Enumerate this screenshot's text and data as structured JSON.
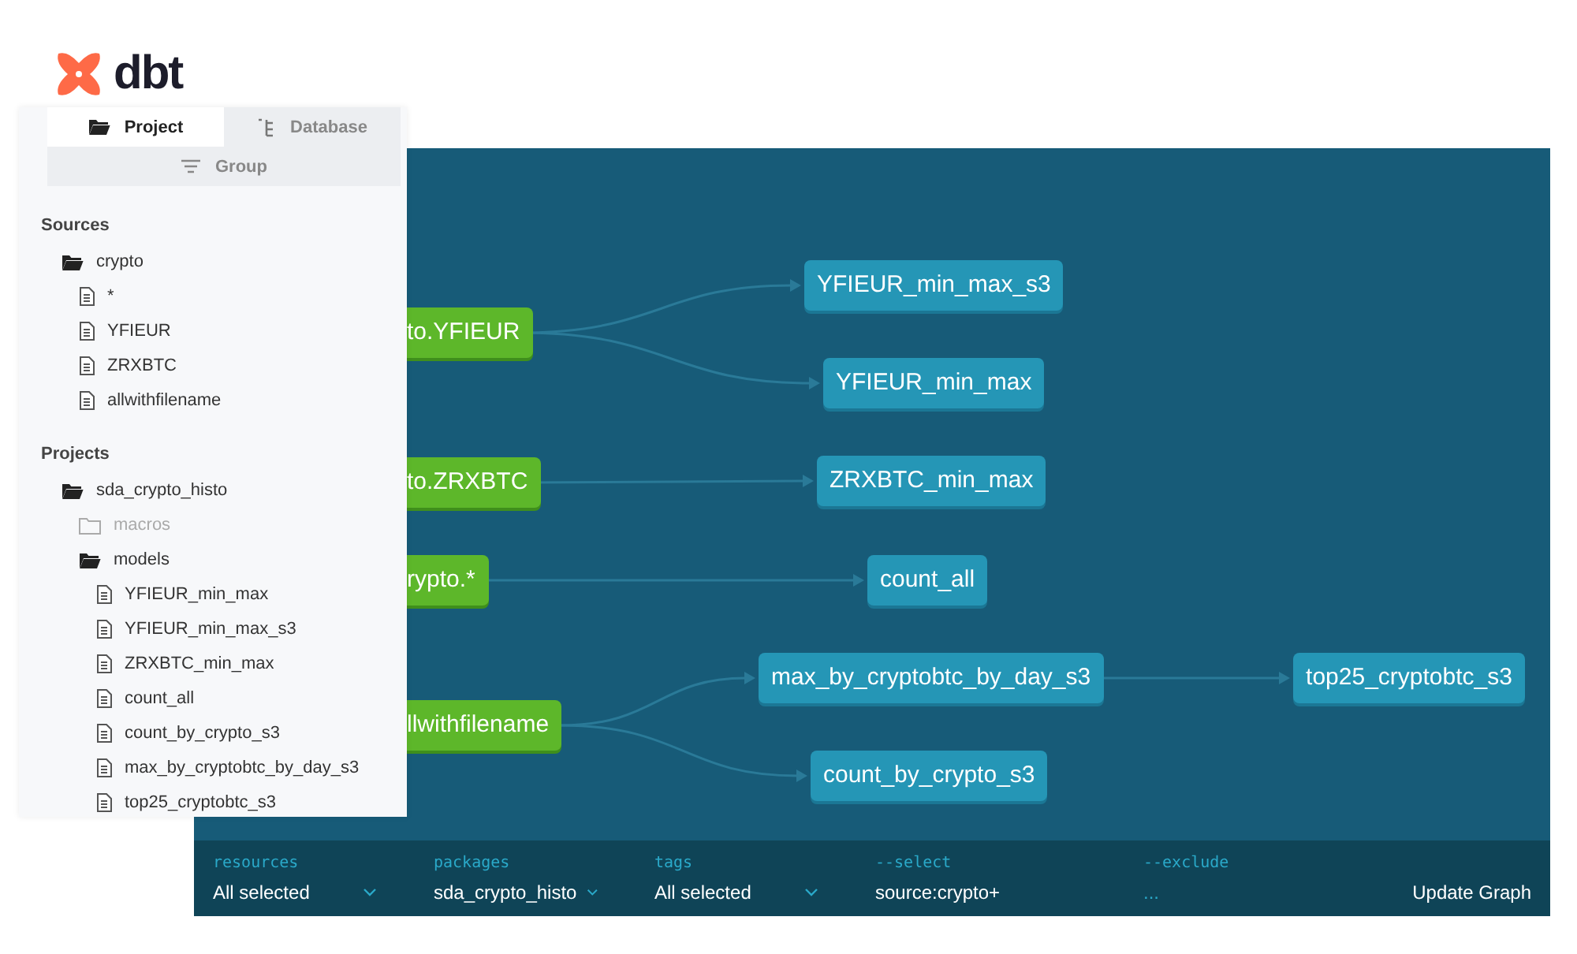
{
  "logo": {
    "text": "dbt"
  },
  "sidebar": {
    "tabs": [
      {
        "label": "Project",
        "selected": true,
        "kind": "folder"
      },
      {
        "label": "Database",
        "selected": false,
        "kind": "tree"
      }
    ],
    "group_button": "Group",
    "sections": [
      {
        "title": "Sources",
        "tree": [
          {
            "label": "crypto",
            "kind": "folder",
            "expanded": true,
            "disabled": false,
            "children": [
              {
                "label": "*",
                "kind": "file"
              },
              {
                "label": "YFIEUR",
                "kind": "file"
              },
              {
                "label": "ZRXBTC",
                "kind": "file"
              },
              {
                "label": "allwithfilename",
                "kind": "file"
              }
            ]
          }
        ]
      },
      {
        "title": "Projects",
        "tree": [
          {
            "label": "sda_crypto_histo",
            "kind": "folder",
            "expanded": true,
            "disabled": false,
            "children": [
              {
                "label": "macros",
                "kind": "folder",
                "expanded": false,
                "disabled": true
              },
              {
                "label": "models",
                "kind": "folder",
                "expanded": true,
                "disabled": false,
                "children": [
                  {
                    "label": "YFIEUR_min_max",
                    "kind": "file"
                  },
                  {
                    "label": "YFIEUR_min_max_s3",
                    "kind": "file"
                  },
                  {
                    "label": "ZRXBTC_min_max",
                    "kind": "file"
                  },
                  {
                    "label": "count_all",
                    "kind": "file"
                  },
                  {
                    "label": "count_by_crypto_s3",
                    "kind": "file"
                  },
                  {
                    "label": "max_by_cryptobtc_by_day_s3",
                    "kind": "file"
                  },
                  {
                    "label": "top25_cryptobtc_s3",
                    "kind": "file"
                  }
                ]
              }
            ]
          }
        ]
      }
    ]
  },
  "graph": {
    "nodes": [
      {
        "label": "to.YFIEUR",
        "kind": "source"
      },
      {
        "label": "to.ZRXBTC",
        "kind": "source"
      },
      {
        "label": "rypto.*",
        "kind": "source"
      },
      {
        "label": "llwithfilename",
        "kind": "source"
      },
      {
        "label": "YFIEUR_min_max_s3",
        "kind": "model"
      },
      {
        "label": "YFIEUR_min_max",
        "kind": "model"
      },
      {
        "label": "ZRXBTC_min_max",
        "kind": "model"
      },
      {
        "label": "count_all",
        "kind": "model"
      },
      {
        "label": "max_by_cryptobtc_by_day_s3",
        "kind": "model"
      },
      {
        "label": "count_by_crypto_s3",
        "kind": "model"
      },
      {
        "label": "top25_cryptobtc_s3",
        "kind": "model"
      }
    ]
  },
  "filters": [
    {
      "label": "resources",
      "kind": "dropdown",
      "value": "All selected"
    },
    {
      "label": "packages",
      "kind": "dropdown",
      "value": "sda_crypto_histo"
    },
    {
      "label": "tags",
      "kind": "dropdown",
      "value": "All selected"
    },
    {
      "label": "--select",
      "kind": "text",
      "value": "source:crypto+"
    },
    {
      "label": "--exclude",
      "kind": "text",
      "placeholder": "..."
    }
  ],
  "update_button": "Update Graph"
}
